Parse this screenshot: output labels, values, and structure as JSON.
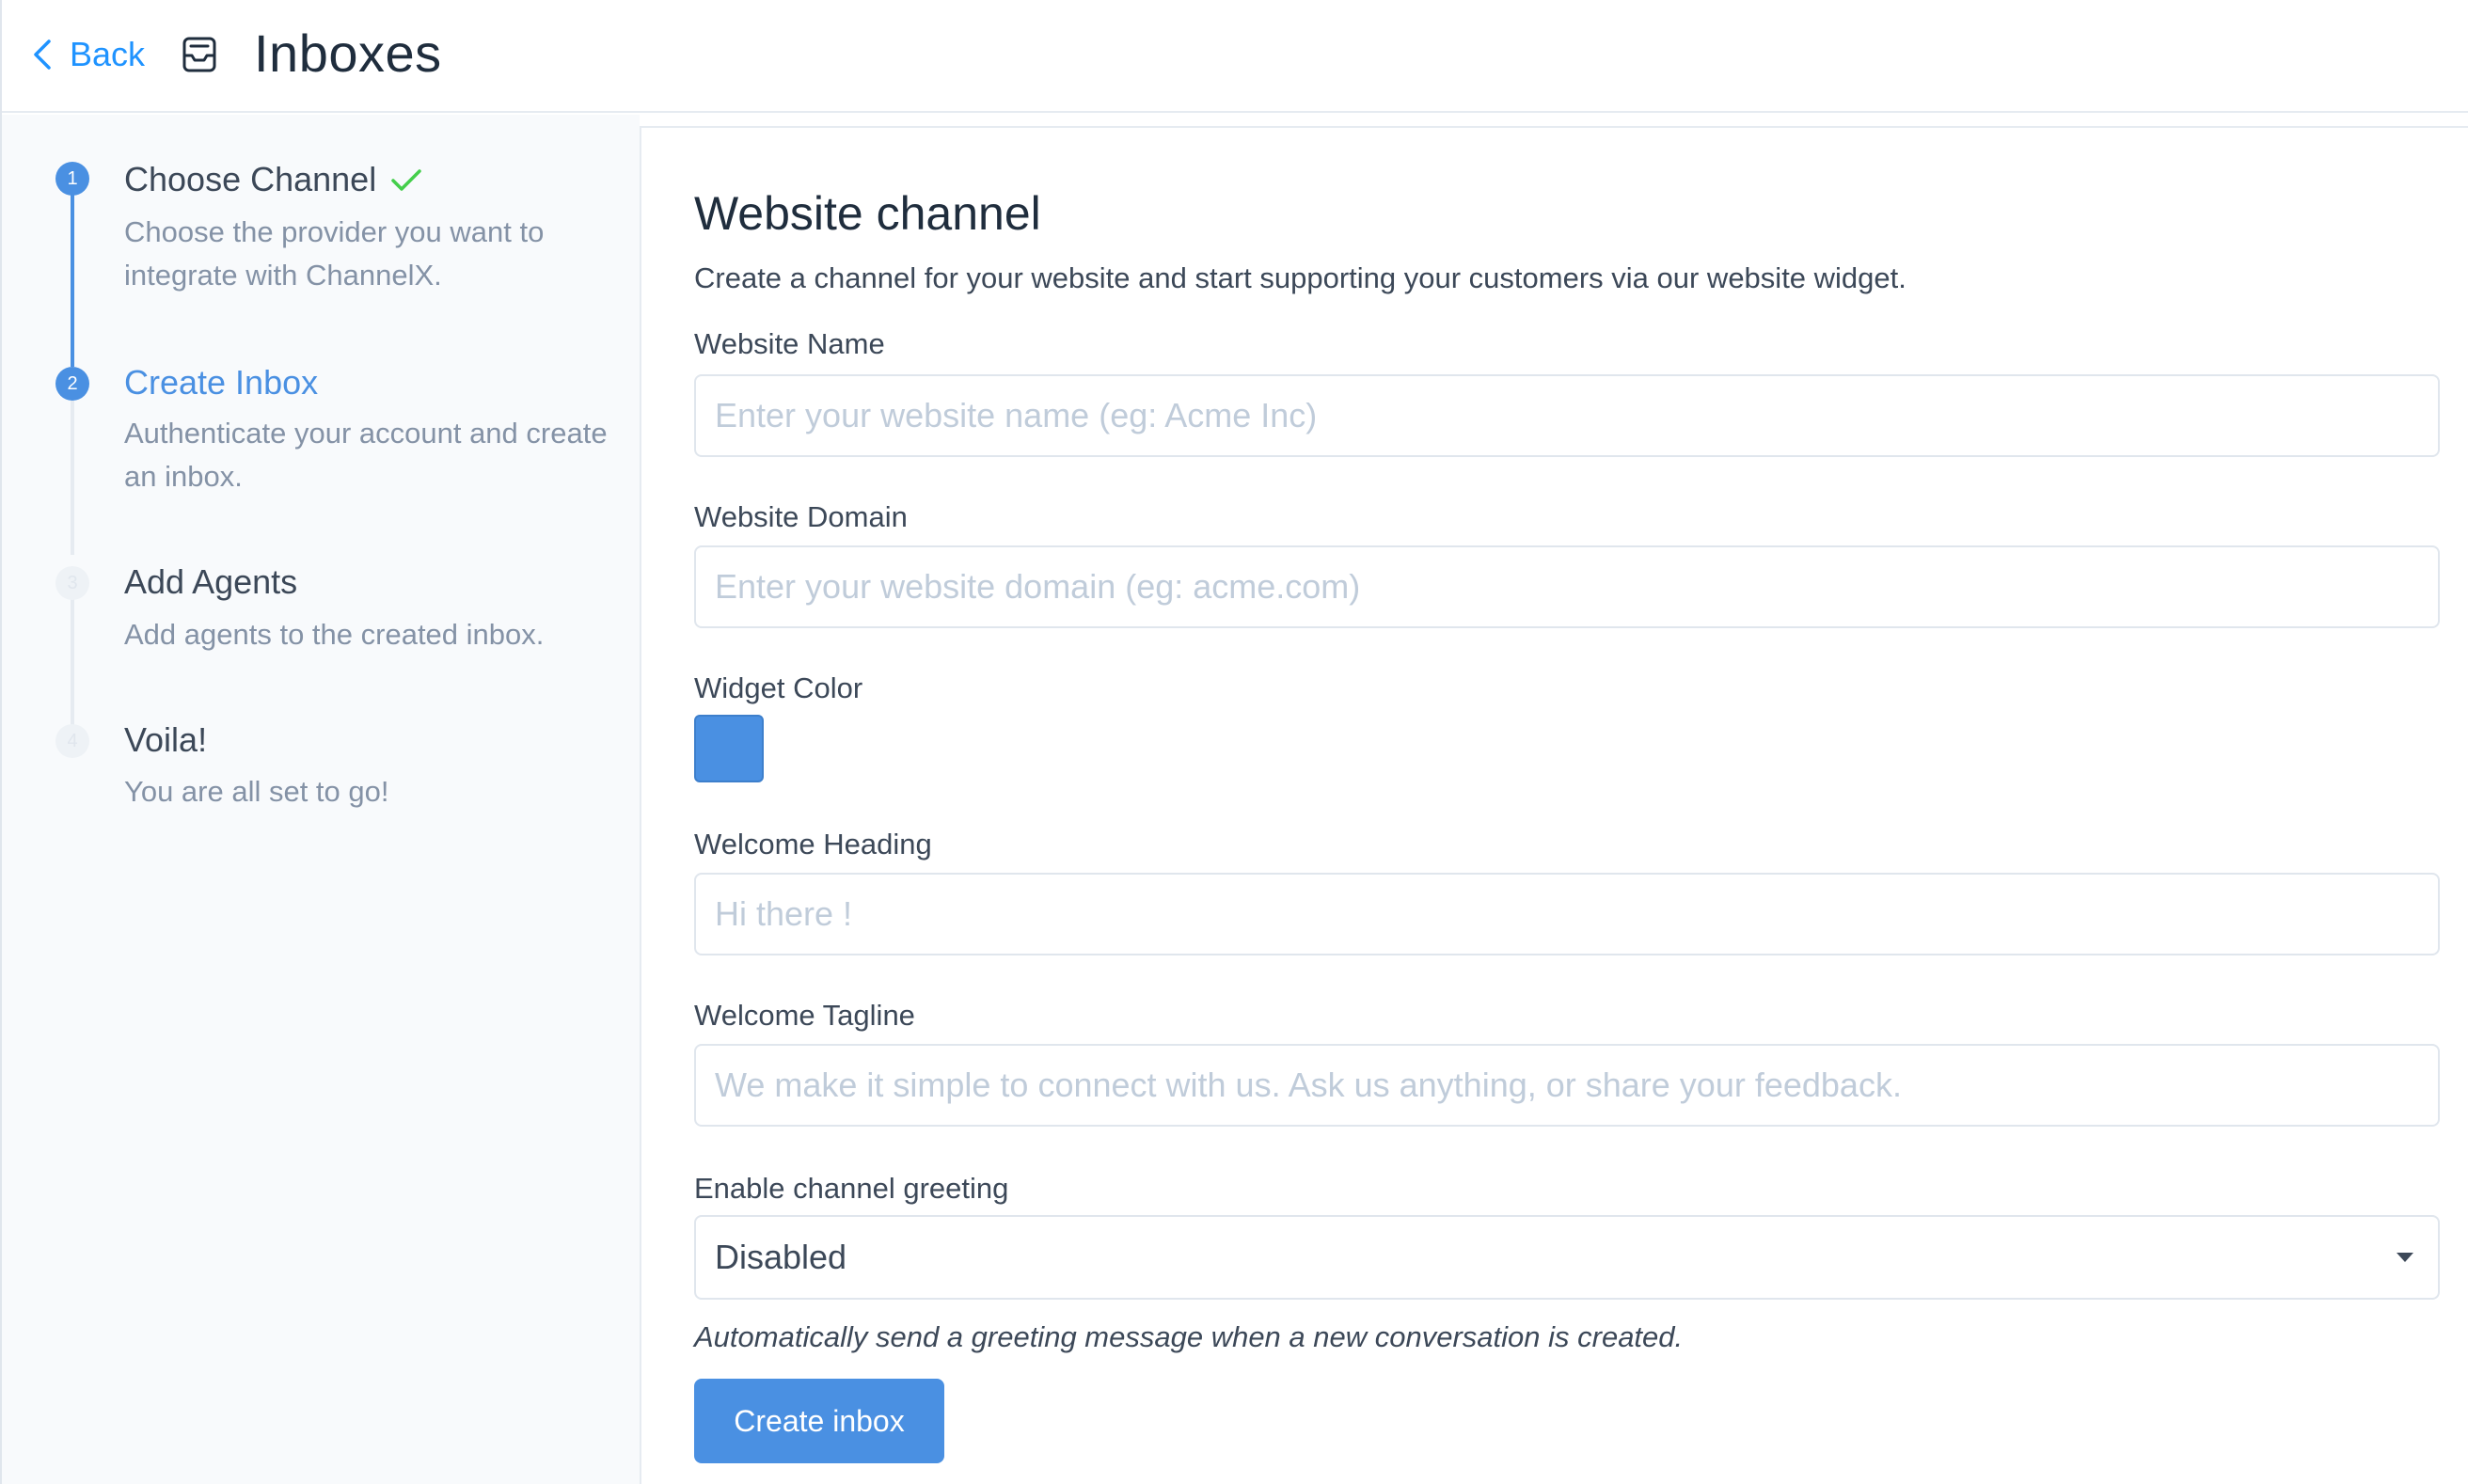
{
  "header": {
    "back_label": "Back",
    "title": "Inboxes"
  },
  "steps": [
    {
      "number": "1",
      "title": "Choose Channel",
      "description": "Choose the provider you want to integrate with ChannelX.",
      "status": "done"
    },
    {
      "number": "2",
      "title": "Create Inbox",
      "description": "Authenticate your account and create an inbox.",
      "status": "current"
    },
    {
      "number": "3",
      "title": "Add Agents",
      "description": "Add agents to the created inbox.",
      "status": "pending"
    },
    {
      "number": "4",
      "title": "Voila!",
      "description": "You are all set to go!",
      "status": "pending"
    }
  ],
  "form": {
    "title": "Website channel",
    "subtitle": "Create a channel for your website and start supporting your customers via our website widget.",
    "website_name": {
      "label": "Website Name",
      "placeholder": "Enter your website name (eg: Acme Inc)",
      "value": ""
    },
    "website_domain": {
      "label": "Website Domain",
      "placeholder": "Enter your website domain (eg: acme.com)",
      "value": ""
    },
    "widget_color": {
      "label": "Widget Color",
      "value": "#4a90e2"
    },
    "welcome_heading": {
      "label": "Welcome Heading",
      "placeholder": "Hi there !",
      "value": ""
    },
    "welcome_tagline": {
      "label": "Welcome Tagline",
      "placeholder": "We make it simple to connect with us. Ask us anything, or share your feedback.",
      "value": ""
    },
    "channel_greeting": {
      "label": "Enable channel greeting",
      "selected": "Disabled",
      "help": "Automatically send a greeting message when a new conversation is created."
    },
    "submit_label": "Create inbox"
  },
  "colors": {
    "accent": "#4a90e2",
    "link": "#1f93ff",
    "success": "#44ce4b"
  }
}
